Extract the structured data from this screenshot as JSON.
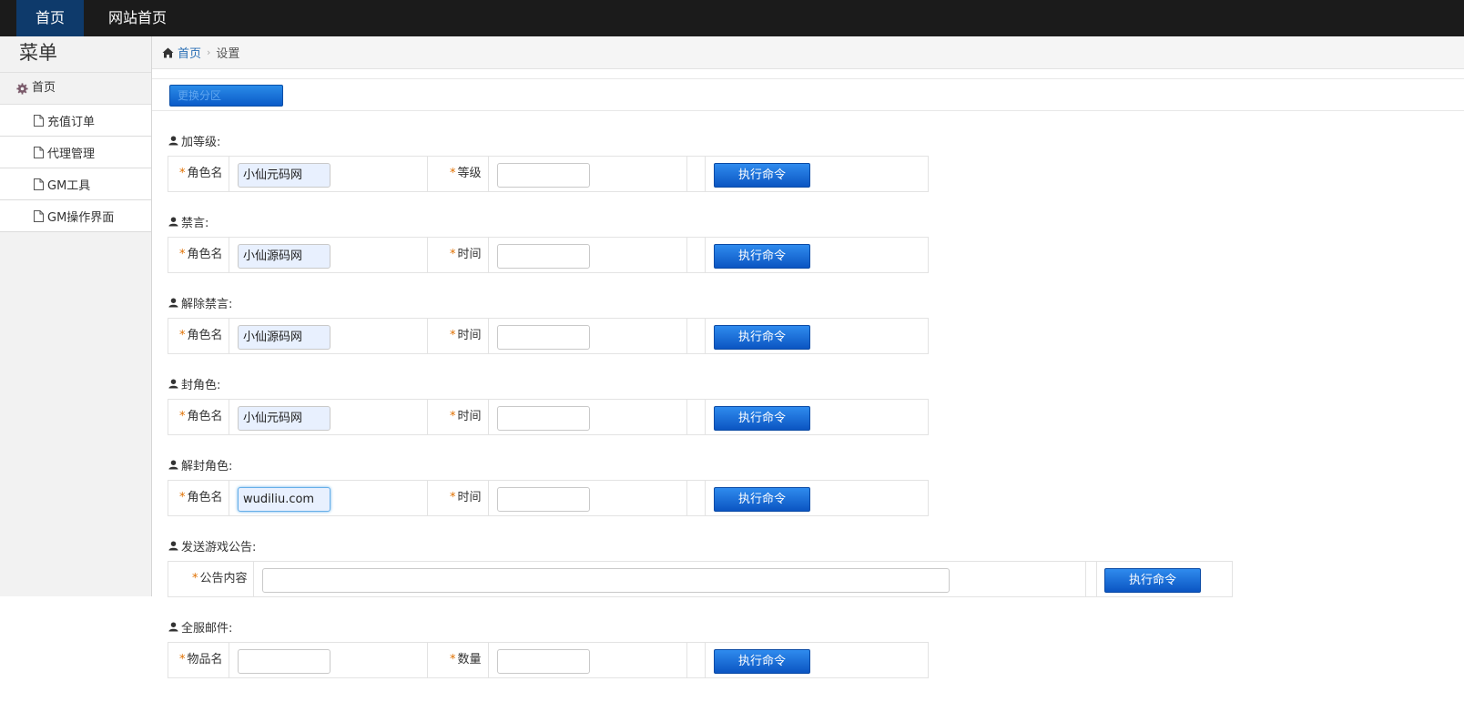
{
  "topnav": {
    "home": "首页",
    "site_home": "网站首页"
  },
  "sidebar": {
    "title": "菜单",
    "category": "首页",
    "items": [
      {
        "label": "充值订单"
      },
      {
        "label": "代理管理"
      },
      {
        "label": "GM工具"
      },
      {
        "label": "GM操作界面"
      }
    ]
  },
  "breadcrumb": {
    "home": "首页",
    "current": "设置"
  },
  "zone_button": "更换分区",
  "sections": [
    {
      "title": "加等级:",
      "label1": "角色名",
      "value1": "小仙元码网",
      "label2": "等级",
      "value2": "",
      "button": "执行命令"
    },
    {
      "title": "禁言:",
      "label1": "角色名",
      "value1": "小仙源码网",
      "label2": "时间",
      "value2": "",
      "button": "执行命令"
    },
    {
      "title": "解除禁言:",
      "label1": "角色名",
      "value1": "小仙源码网",
      "label2": "时间",
      "value2": "",
      "button": "执行命令"
    },
    {
      "title": "封角色:",
      "label1": "角色名",
      "value1": "小仙元码网",
      "label2": "时间",
      "value2": "",
      "button": "执行命令"
    },
    {
      "title": "解封角色:",
      "label1": "角色名",
      "value1": "wudiliu.com",
      "label2": "时间",
      "value2": "",
      "button": "执行命令"
    }
  ],
  "announcement": {
    "title": "发送游戏公告:",
    "label": "公告内容",
    "value": "",
    "button": "执行命令"
  },
  "mail": {
    "title": "全服邮件:",
    "label1": "物品名",
    "value1": "",
    "label2": "数量",
    "value2": "",
    "button": "执行命令"
  },
  "colors": {
    "topbar": "#1b1b1b",
    "nav_active": "#0e3a6b",
    "button": "#0b55c2",
    "required_star": "#e07000",
    "link": "#2a6fb5"
  }
}
